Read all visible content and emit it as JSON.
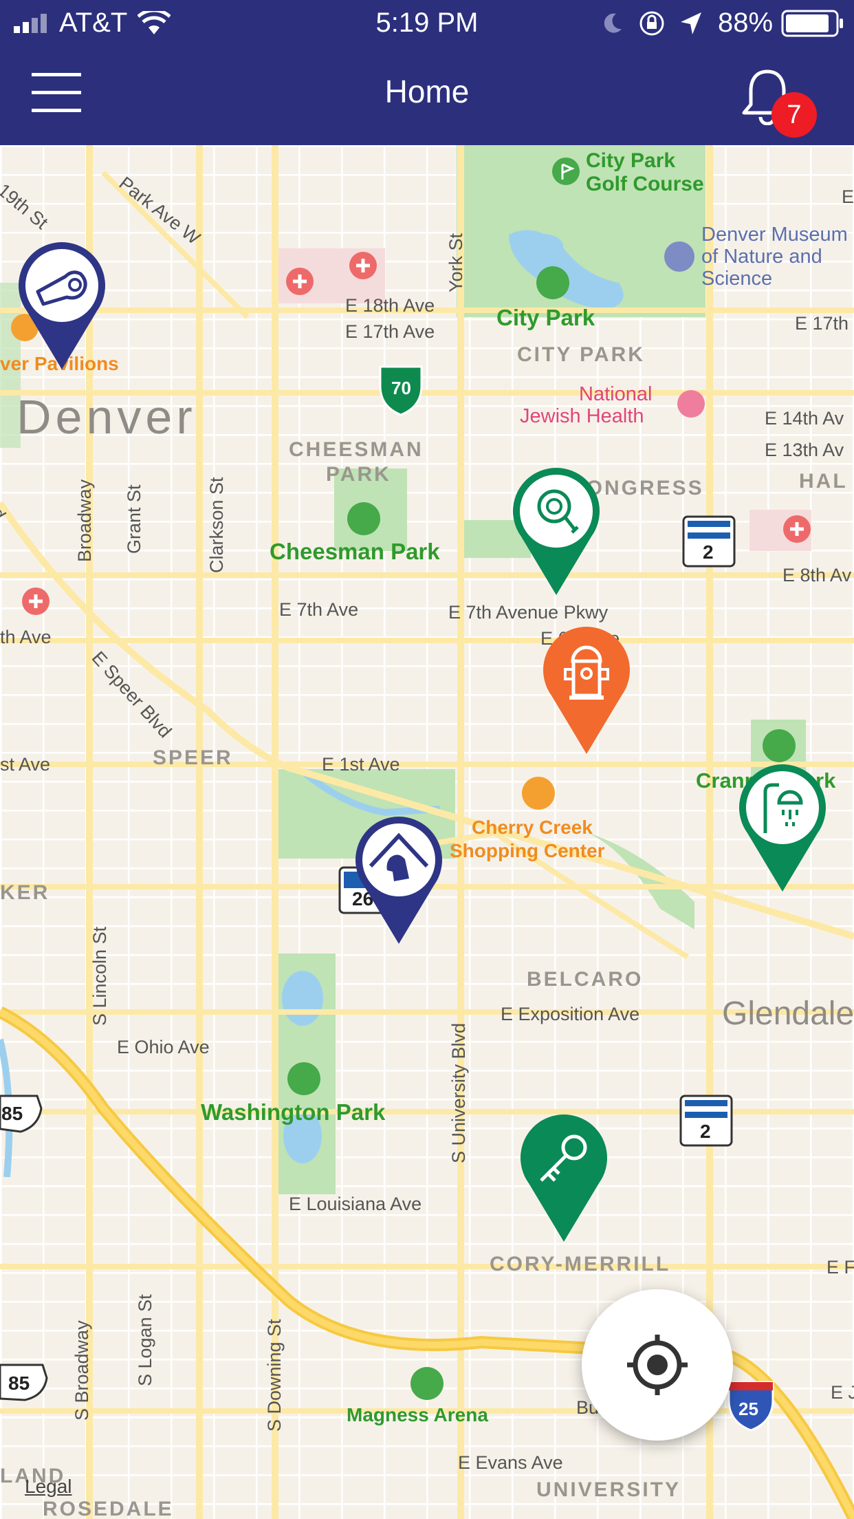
{
  "status_bar": {
    "carrier": "AT&T",
    "time": "5:19 PM",
    "battery": "88%",
    "icons": [
      "signal-icon",
      "wifi-icon",
      "moon-icon",
      "rotation-lock-icon",
      "location-arrow-icon",
      "battery-icon"
    ]
  },
  "nav": {
    "title": "Home",
    "notification_count": "7",
    "menu_icon": "hamburger-menu-icon",
    "bell_icon": "bell-icon"
  },
  "map": {
    "city_label": "Denver",
    "glendale_label": "Glendale",
    "districts": [
      "CITY PARK",
      "CHEESMAN",
      "PARK",
      "SPEER",
      "BELCARO",
      "CORY-MERRILL",
      "UNIVERSITY",
      "PARK",
      "HAL",
      "KER",
      "LAND",
      "ROSEDALE",
      "CONGRESS",
      "PARK"
    ],
    "parks": {
      "city_park_golf_1": "City Park",
      "city_park_golf_2": "Golf Course",
      "city_park": "City Park",
      "cheesman_park": "Cheesman Park",
      "washington_park": "Washington Park",
      "cranmer_park": "Cranmer Park"
    },
    "pois": {
      "museum_1": "Denver Museum",
      "museum_2": "of Nature and",
      "museum_3": "Science",
      "jewish_1": "National",
      "jewish_2": "Jewish Health",
      "pavilions": "ver Pavilions",
      "cherry_1": "Cherry Creek",
      "cherry_2": "Shopping Center",
      "magness": "Magness Arena"
    },
    "streets": {
      "e18th": "E 18th Ave",
      "e17th": "E 17th Ave",
      "e17th_r": "E 17th",
      "e14th": "E 14th Av",
      "e13th": "E 13th Av",
      "e8th": "E 8th Av",
      "e7th": "E 7th Ave",
      "e7th_pkwy": "E 7th Avenue Pkwy",
      "e6th": "E 6th Ave",
      "th_ave": "th Ave",
      "e1st": "E 1st Ave",
      "st_ave": "st Ave",
      "e_exposition": "E Exposition Ave",
      "e_ohio": "E Ohio Ave",
      "e_louisiana": "E Louisiana Ave",
      "e_evans": "E Evans Ave",
      "e_f": "E F",
      "e_j": "E J",
      "e_speer": "E Speer Blvd",
      "park_ave_w": "Park Ave W",
      "19th_st": "19th St",
      "york": "York St",
      "broadway": "Broadway",
      "grant": "Grant St",
      "clarkson": "Clarkson St",
      "s_lincoln": "S Lincoln St",
      "s_university": "S University Blvd",
      "s_broadway": "S Broadway",
      "s_logan": "S Logan St",
      "s_downing": "S Downing St",
      "blvd": "vd",
      "bu": "Bu",
      "e_right": "E"
    },
    "shields": {
      "i70": "70",
      "i25": "25",
      "us85_a": "85",
      "us85_b": "85",
      "co2_a": "2",
      "co2_b": "2",
      "us26": "26"
    },
    "legal": "Legal",
    "pins": [
      {
        "name": "whistle-pin",
        "icon": "whistle-icon",
        "color": "#2e3586"
      },
      {
        "name": "leash-pin",
        "icon": "leash-icon",
        "color": "#0a8a56"
      },
      {
        "name": "fire-hydrant-pin",
        "icon": "fire-hydrant-icon",
        "color": "#f26a2e"
      },
      {
        "name": "shower-pin",
        "icon": "shower-icon",
        "color": "#0a8a56"
      },
      {
        "name": "dog-house-pin",
        "icon": "dog-house-icon",
        "color": "#2e3586"
      },
      {
        "name": "key-pin",
        "icon": "key-icon",
        "color": "#0a8a56"
      }
    ]
  },
  "fab": {
    "icon": "locate-me-icon"
  }
}
